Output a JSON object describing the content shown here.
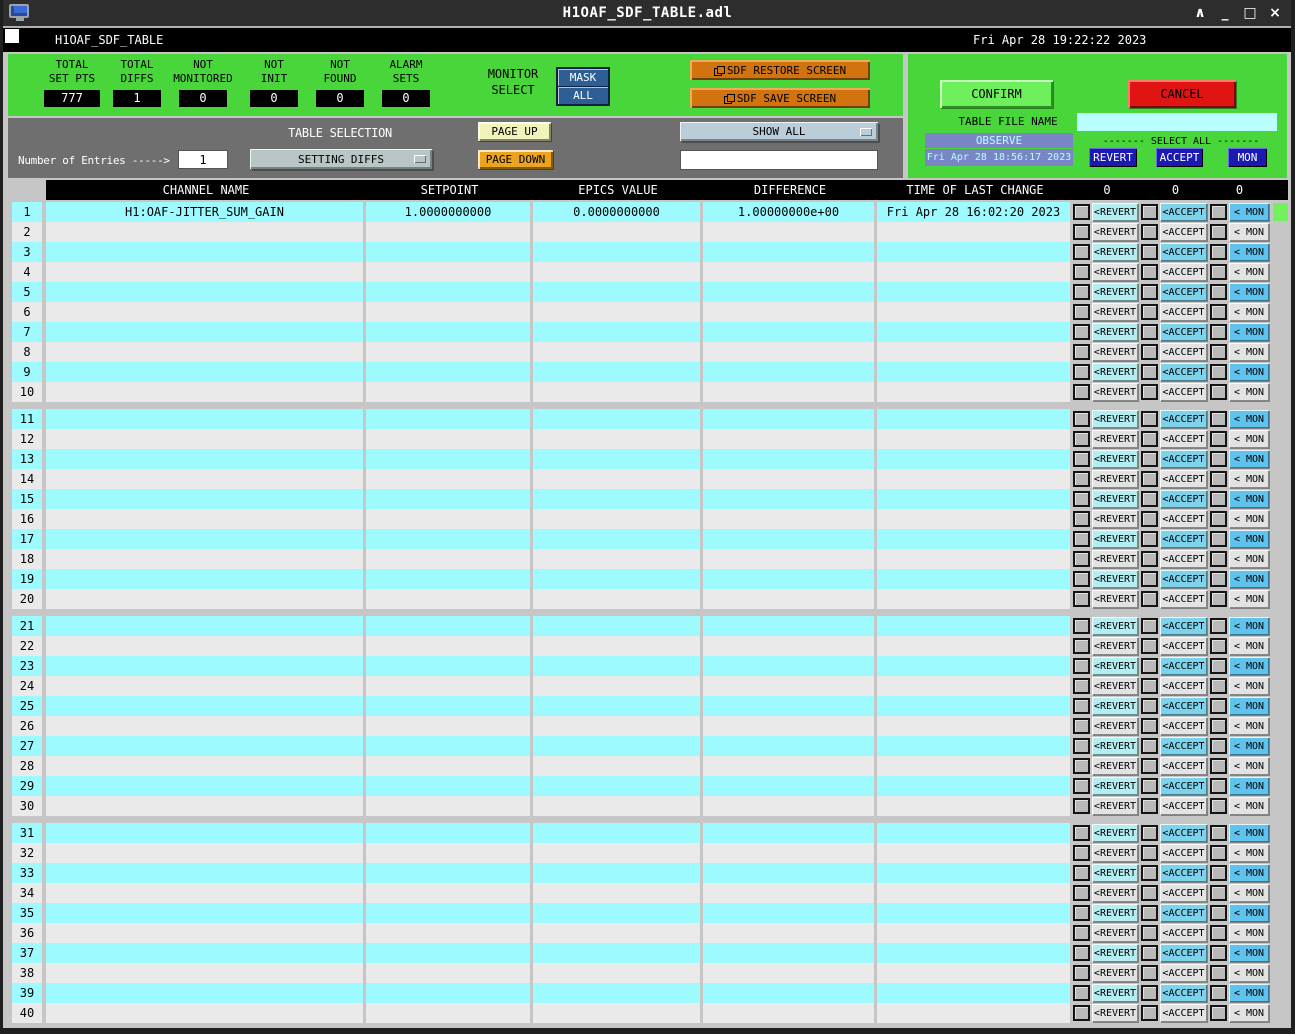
{
  "window": {
    "title": "H1OAF_SDF_TABLE.adl",
    "controls": {
      "shade": "∧",
      "minimize": "_",
      "maximize": "□",
      "close": "×"
    }
  },
  "menubar": {
    "title": "H1OAF_SDF_TABLE",
    "datetime": "Fri Apr 28 19:22:22 2023"
  },
  "stats": [
    {
      "line1": "TOTAL",
      "line2": "SET PTS",
      "value": "777"
    },
    {
      "line1": "TOTAL",
      "line2": "DIFFS",
      "value": "1"
    },
    {
      "line1": "NOT",
      "line2": "MONITORED",
      "value": "0"
    },
    {
      "line1": "NOT",
      "line2": "INIT",
      "value": "0"
    },
    {
      "line1": "NOT",
      "line2": "FOUND",
      "value": "0"
    },
    {
      "line1": "ALARM",
      "line2": "SETS",
      "value": "0"
    }
  ],
  "monitor_select": {
    "line1": "MONITOR",
    "line2": "SELECT",
    "mask": "MASK",
    "all": "ALL"
  },
  "sdf_buttons": {
    "restore": "SDF RESTORE SCREEN",
    "save": "SDF SAVE SCREEN"
  },
  "right_panel": {
    "confirm": "CONFIRM",
    "cancel": "CANCEL",
    "table_file_name": "TABLE FILE NAME",
    "file_value": "",
    "mode": "OBSERVE",
    "mode_time": "Fri Apr 28 18:56:17 2023",
    "select_all": "------- SELECT ALL -------",
    "revert": "REVERT",
    "accept": "ACCEPT",
    "mon": "MON"
  },
  "controls": {
    "table_selection": "TABLE SELECTION",
    "entries_label": "Number of Entries ----->",
    "entries_value": "1",
    "table_dropdown": "SETTING DIFFS",
    "page_up": "PAGE UP",
    "page_down": "PAGE DOWN",
    "show_dropdown": "SHOW ALL",
    "filter_value": ""
  },
  "table": {
    "headers": [
      "CHANNEL NAME",
      "SETPOINT",
      "EPICS VALUE",
      "DIFFERENCE",
      "TIME OF LAST CHANGE",
      "0",
      "0",
      "0"
    ],
    "row_buttons": [
      "<REVERT",
      "<ACCEPT",
      "< MON"
    ],
    "row_count": 40,
    "group_size": 10,
    "rows": [
      {
        "num": 1,
        "channel": "H1:OAF-JITTER_SUM_GAIN",
        "setpoint": "1.0000000000",
        "epics": "0.0000000000",
        "difference": "1.00000000e+00",
        "time": "Fri Apr 28 16:02:20 2023",
        "has_diff": true
      }
    ]
  },
  "colors": {
    "panel_green": "#49d63a",
    "panel_gray": "#6f6f6f",
    "window_gray": "#c6c6c6",
    "row_cyan": "#9dfbff",
    "row_white": "#eaeaea",
    "orange_button": "#d1740f",
    "confirm_green": "#6ef05d",
    "cancel_red": "#e11414",
    "navy_button": "#1a1ab2",
    "observe_bg": "#7a85c6",
    "observe_text": "#b9ffff",
    "diff_indicator": "#72f05e",
    "revert_btn_cyan": "#b2eef2",
    "accept_btn_cyan": "#7ed3ec",
    "mon_btn_cyan": "#5fc3ee"
  }
}
